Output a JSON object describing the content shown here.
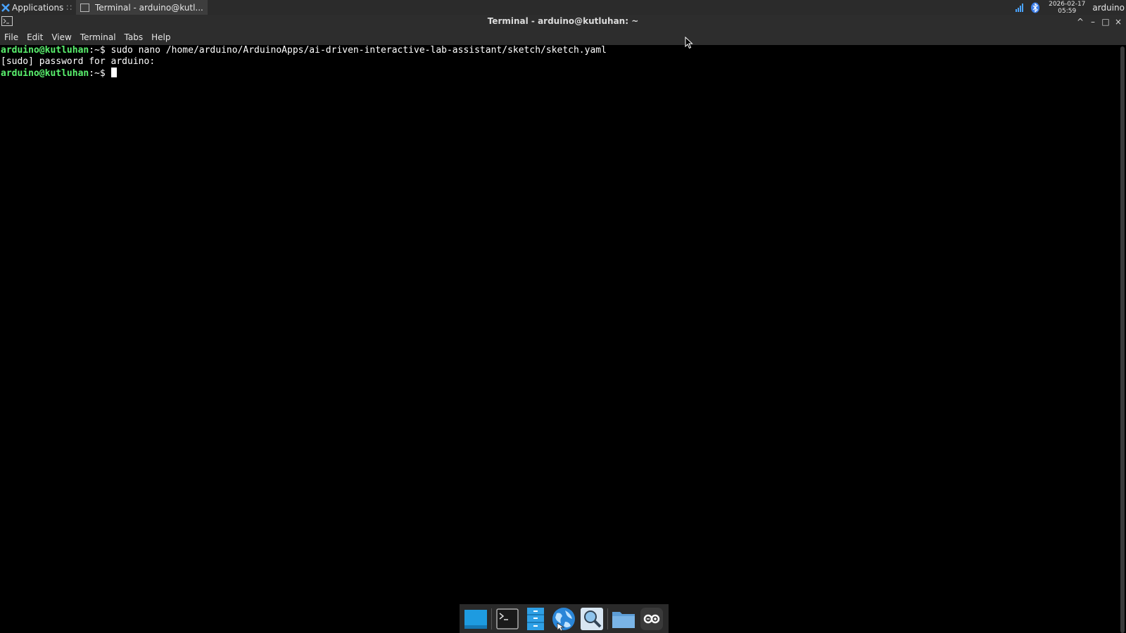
{
  "panel": {
    "applications_label": "Applications",
    "applications_suffix": "∷",
    "task_label": "Terminal - arduino@kutl...",
    "clock_date": "2026-02-17",
    "clock_time": "05:59",
    "user": "arduino"
  },
  "window": {
    "title": "Terminal - arduino@kutluhan: ~",
    "controls": [
      "^",
      "–",
      "□",
      "×"
    ]
  },
  "menu": [
    "File",
    "Edit",
    "View",
    "Terminal",
    "Tabs",
    "Help"
  ],
  "terminal": {
    "prompt": "arduino@kutluhan",
    "prompt_suffix": ":~$",
    "command": " sudo nano /home/arduino/ArduinoApps/ai-driven-interactive-lab-assistant/sketch/sketch.yaml",
    "output": "[sudo] password for arduino:"
  },
  "dock": [
    "show-desktop-icon",
    "terminal-icon",
    "file-manager-icon",
    "web-browser-icon",
    "app-finder-icon",
    "folder-icon",
    "arduino-app-lab-icon"
  ],
  "colors": {
    "prompt": "#5af26e",
    "panel": "#2b2b2b",
    "terminal_bg": "#000000"
  }
}
